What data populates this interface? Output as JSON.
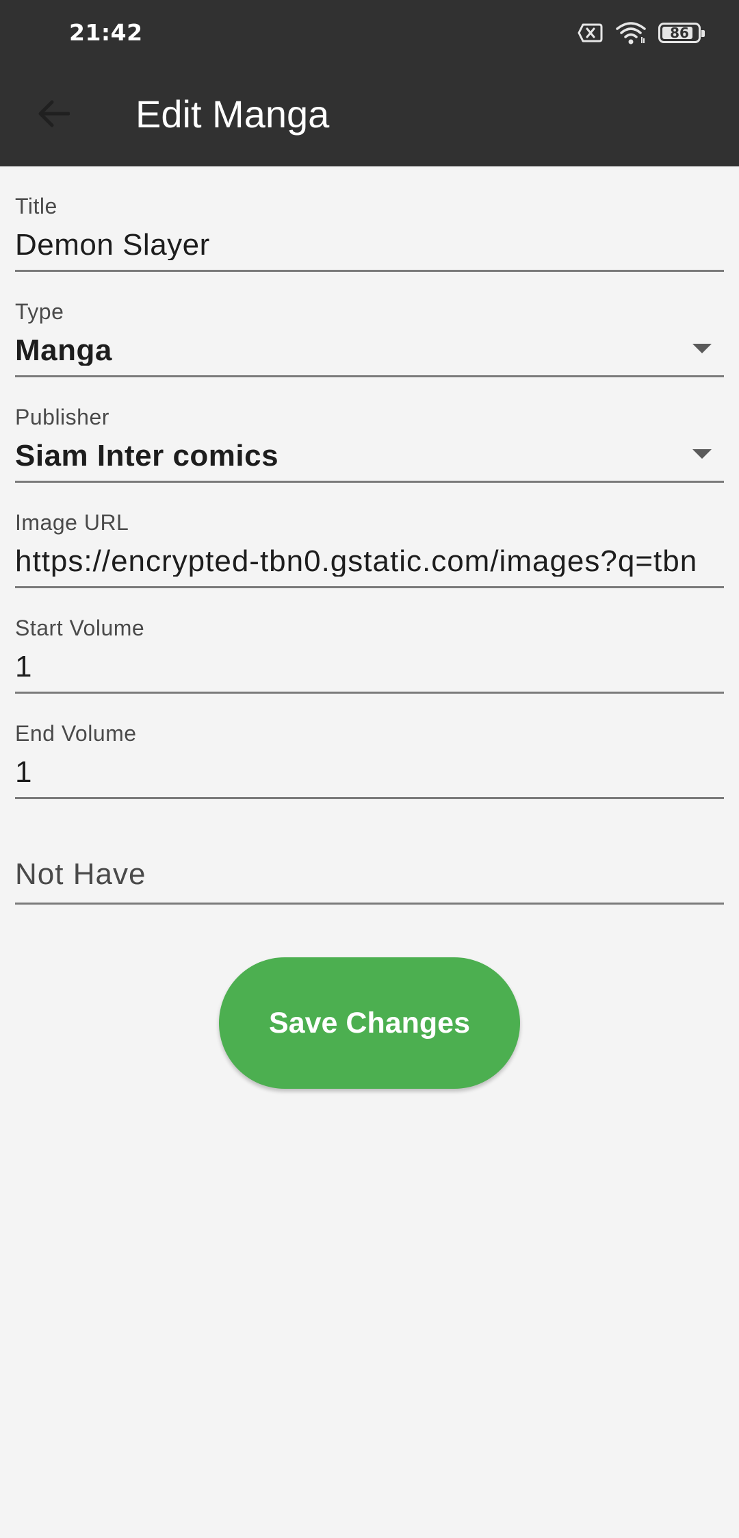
{
  "status_bar": {
    "time": "21:42",
    "battery_level": "86",
    "icons": [
      "sim-off-icon",
      "wifi-icon",
      "battery-icon"
    ]
  },
  "app_bar": {
    "title": "Edit Manga",
    "back_icon": "arrow-back-icon"
  },
  "form": {
    "title": {
      "label": "Title",
      "value": "Demon Slayer"
    },
    "type": {
      "label": "Type",
      "value": "Manga"
    },
    "publisher": {
      "label": "Publisher",
      "value": "Siam Inter comics"
    },
    "image_url": {
      "label": "Image URL",
      "value": "https://encrypted-tbn0.gstatic.com/images?q=tbn"
    },
    "start_volume": {
      "label": "Start Volume",
      "value": "1"
    },
    "end_volume": {
      "label": "End Volume",
      "value": "1"
    },
    "not_have": {
      "placeholder": "Not Have"
    }
  },
  "actions": {
    "save_label": "Save Changes"
  },
  "colors": {
    "app_bar": "#313131",
    "background": "#f4f4f4",
    "accent": "#4caf50"
  }
}
